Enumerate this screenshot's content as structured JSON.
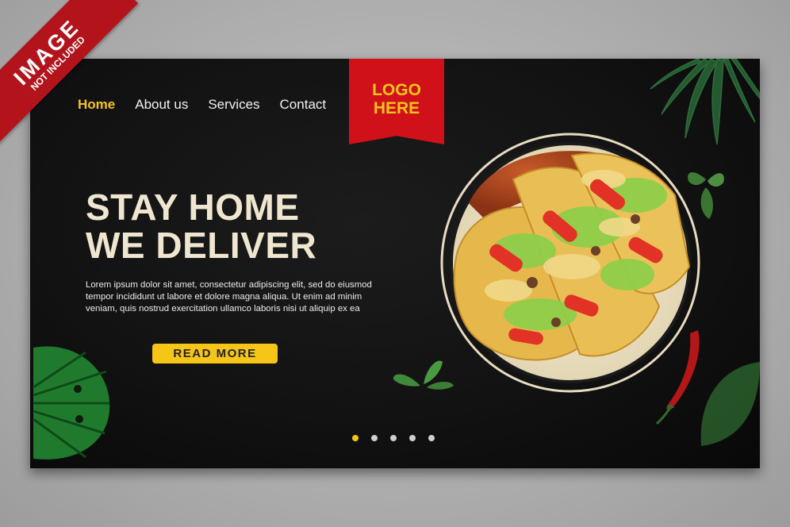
{
  "badge": {
    "line1": "IMAGE",
    "line2": "NOT INCLUDED"
  },
  "nav": {
    "items": [
      {
        "label": "Home",
        "active": true
      },
      {
        "label": "About us",
        "active": false
      },
      {
        "label": "Services",
        "active": false
      },
      {
        "label": "Contact",
        "active": false
      }
    ]
  },
  "logo": {
    "line1": "LOGO",
    "line2": "HERE"
  },
  "hero": {
    "title_line1": "STAY HOME",
    "title_line2": "WE DELIVER",
    "body": "Lorem ipsum dolor sit amet, consectetur adipiscing elit, sed do eiusmod tempor incididunt ut labore et dolore magna aliqua. Ut enim ad minim veniam, quis nostrud exercitation ullamco laboris nisi ut aliquip ex ea",
    "cta_label": "READ MORE"
  },
  "carousel": {
    "slides": 5,
    "active_index": 0
  },
  "colors": {
    "accent": "#f5c518",
    "logo_red": "#d0111a",
    "badge_red": "#b3141c",
    "title_cream": "#efe6d0",
    "background": "#121212"
  },
  "icons": [
    "monstera-leaf-icon",
    "palm-leaf-icon",
    "basil-leaf-icon",
    "chili-pepper-icon",
    "taco-plate-image"
  ]
}
